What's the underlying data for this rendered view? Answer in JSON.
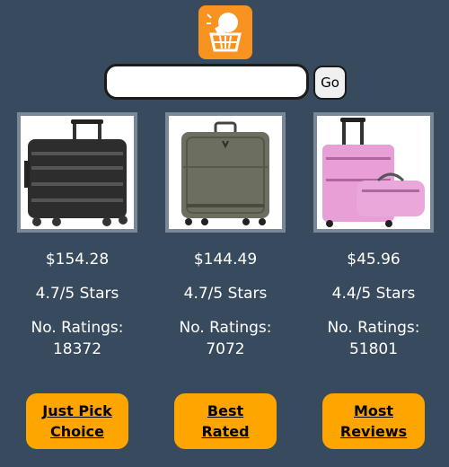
{
  "header": {
    "logo_icon": "basket-lightbulb-icon",
    "brand_color": "#f7931e"
  },
  "search": {
    "value": "",
    "placeholder": "",
    "button_label": "Go"
  },
  "products": [
    {
      "image_icon": "black-hardshell-suitcase",
      "price": "$154.28",
      "stars": "4.7/5 Stars",
      "ratings_label": "No. Ratings:",
      "ratings_count": "18372"
    },
    {
      "image_icon": "olive-softside-carry-on",
      "price": "$144.49",
      "stars": "4.7/5 Stars",
      "ratings_label": "No. Ratings:",
      "ratings_count": "7072"
    },
    {
      "image_icon": "pink-luggage-set",
      "price": "$45.96",
      "stars": "4.4/5 Stars",
      "ratings_label": "No. Ratings:",
      "ratings_count": "51801"
    }
  ],
  "actions": {
    "just_pick": "Just Pick Choice",
    "best_rated": "Best Rated",
    "most_reviews": "Most Reviews"
  },
  "colors": {
    "background": "#384a5e",
    "button": "#ffa500",
    "image_frame": "#7a8796"
  }
}
